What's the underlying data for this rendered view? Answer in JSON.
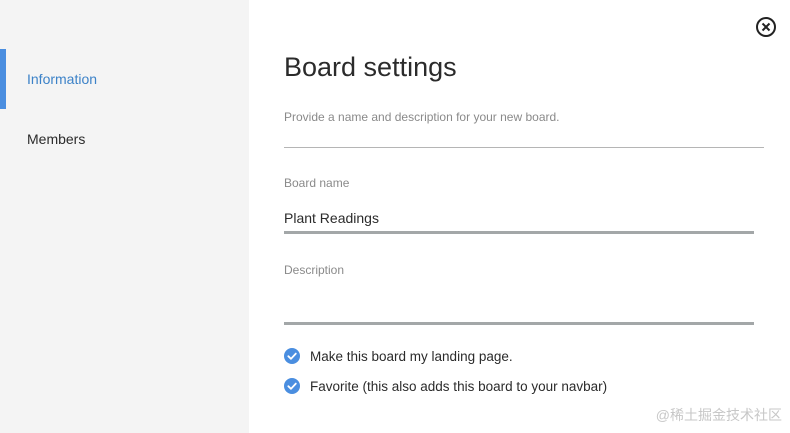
{
  "sidebar": {
    "items": [
      {
        "label": "Information",
        "active": true
      },
      {
        "label": "Members",
        "active": false
      }
    ]
  },
  "header": {
    "title": "Board settings",
    "subtitle": "Provide a name and description for your new board."
  },
  "form": {
    "board_name": {
      "label": "Board name",
      "value": "Plant Readings"
    },
    "description": {
      "label": "Description",
      "value": ""
    },
    "checkboxes": [
      {
        "label": "Make this board my landing page.",
        "checked": true
      },
      {
        "label": "Favorite (this also adds this board to your navbar)",
        "checked": true
      }
    ]
  },
  "icons": {
    "close": "close-circle-icon",
    "checkbox": "checkmark-filled-circle-icon"
  },
  "colors": {
    "accent": "#4a8ee0",
    "active_text": "#3c82c8",
    "sidebar_bg": "#f4f4f4",
    "input_border": "#a3a7a8"
  },
  "watermark": "@稀土掘金技术社区"
}
